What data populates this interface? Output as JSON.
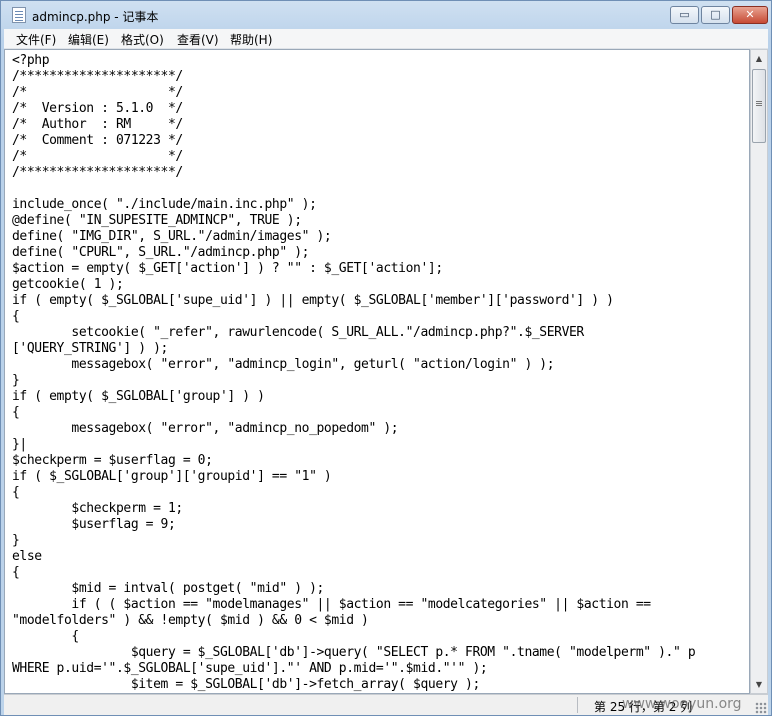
{
  "window": {
    "title": "admincp.php - 记事本",
    "min_glyph": "▭",
    "max_glyph": "□",
    "close_glyph": "✕"
  },
  "menu": [
    "文件(F)",
    "编辑(E)",
    "格式(O)",
    "查看(V)",
    "帮助(H)"
  ],
  "editor": {
    "content": "<?php\n/*********************/\n/*                   */\n/*  Version : 5.1.0  */\n/*  Author  : RM     */\n/*  Comment : 071223 */\n/*                   */\n/*********************/\n\ninclude_once( \"./include/main.inc.php\" );\n@define( \"IN_SUPESITE_ADMINCP\", TRUE );\ndefine( \"IMG_DIR\", S_URL.\"/admin/images\" );\ndefine( \"CPURL\", S_URL.\"/admincp.php\" );\n$action = empty( $_GET['action'] ) ? \"\" : $_GET['action'];\ngetcookie( 1 );\nif ( empty( $_SGLOBAL['supe_uid'] ) || empty( $_SGLOBAL['member']['password'] ) )\n{\n        setcookie( \"_refer\", rawurlencode( S_URL_ALL.\"/admincp.php?\".$_SERVER\n['QUERY_STRING'] ) );\n        messagebox( \"error\", \"admincp_login\", geturl( \"action/login\" ) );\n}\nif ( empty( $_SGLOBAL['group'] ) )\n{\n        messagebox( \"error\", \"admincp_no_popedom\" );\n}|\n$checkperm = $userflag = 0;\nif ( $_SGLOBAL['group']['groupid'] == \"1\" )\n{\n        $checkperm = 1;\n        $userflag = 9;\n}\nelse\n{\n        $mid = intval( postget( \"mid\" ) );\n        if ( ( $action == \"modelmanages\" || $action == \"modelcategories\" || $action ==\n\"modelfolders\" ) && !empty( $mid ) && 0 < $mid )\n        {\n                $query = $_SGLOBAL['db']->query( \"SELECT p.* FROM \".tname( \"modelperm\" ).\" p\nWHERE p.uid='\".$_SGLOBAL['supe_uid'].\"' AND p.mid='\".$mid.\"'\" );\n                $item = $_SGLOBAL['db']->fetch_array( $query );"
  },
  "scrollbar": {
    "up_glyph": "▲",
    "down_glyph": "▼"
  },
  "statusbar": {
    "position": "第 25 行，第 2 列"
  },
  "watermark": "www.wooyun.org"
}
